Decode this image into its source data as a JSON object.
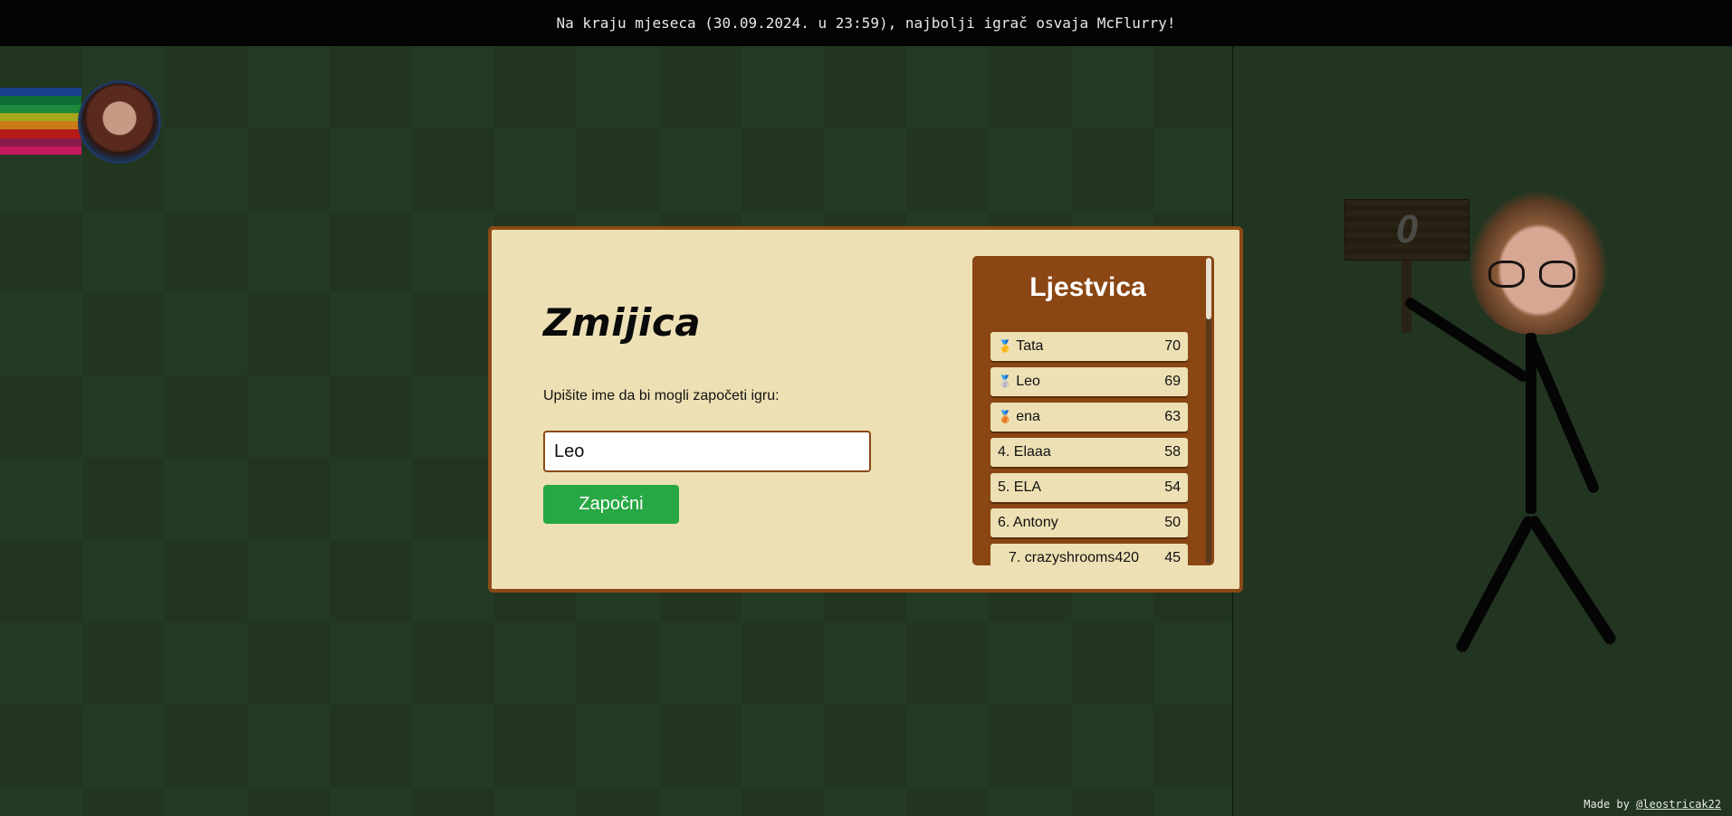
{
  "banner": {
    "text": "Na kraju mjeseca (30.09.2024. u 23:59), najbolji igrač osvaja McFlurry!"
  },
  "score": {
    "value": "0"
  },
  "modal": {
    "title": "Zmijica",
    "prompt": "Upišite ime da bi mogli započeti igru:",
    "name_value": "Leo",
    "start_label": "Započni"
  },
  "leaderboard": {
    "title": "Ljestvica",
    "entries": [
      {
        "label": "Tata",
        "medal": "🥇",
        "score": "70"
      },
      {
        "label": "Leo",
        "medal": "🥈",
        "score": "69"
      },
      {
        "label": "ena",
        "medal": "🥉",
        "score": "63"
      },
      {
        "label": "4. Elaaa",
        "medal": "",
        "score": "58"
      },
      {
        "label": "5. ELA",
        "medal": "",
        "score": "54"
      },
      {
        "label": "6. Antony",
        "medal": "",
        "score": "50"
      },
      {
        "label": "7. crazyshrooms420",
        "medal": "",
        "score": "45"
      }
    ]
  },
  "credit": {
    "prefix": "Made by ",
    "handle": "@leostricak22"
  },
  "snake_colors": [
    "#1a3f8c",
    "#0f6b34",
    "#1c8a3a",
    "#a6a61a",
    "#c97a14",
    "#b41a1a",
    "#8a1a4a",
    "#c21a5a"
  ]
}
